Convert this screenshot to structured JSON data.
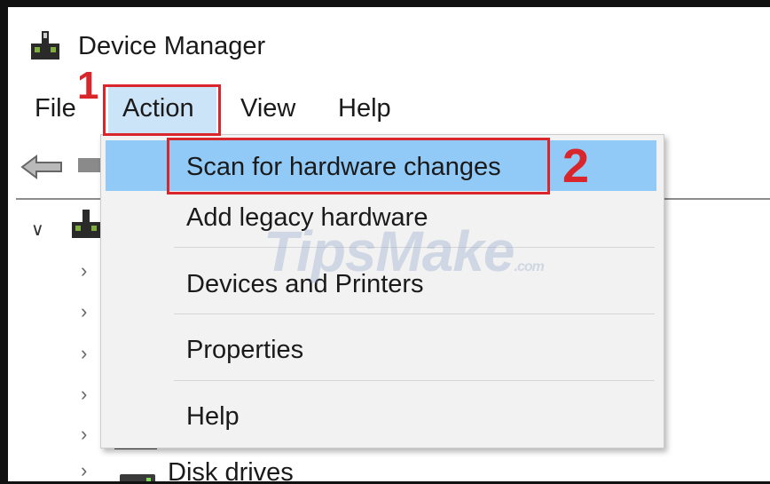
{
  "window": {
    "title": "Device Manager"
  },
  "menubar": {
    "items": [
      "File",
      "Action",
      "View",
      "Help"
    ],
    "active": "Action"
  },
  "dropdown": {
    "items": [
      {
        "label": "Scan for hardware changes",
        "highlighted": true
      },
      {
        "label": "Add legacy hardware"
      },
      {
        "label": "Devices and Printers"
      },
      {
        "label": "Properties"
      },
      {
        "label": "Help"
      }
    ]
  },
  "tree": {
    "visible_nodes": [
      {
        "label": "Disk drives"
      }
    ]
  },
  "annotations": {
    "step1": "1",
    "step2": "2",
    "color": "#d9262c"
  },
  "watermark": {
    "text": "TipsMake",
    "suffix": ".com"
  },
  "colors": {
    "menu_active_bg": "#cce4f7",
    "dropdown_bg": "#f2f2f2",
    "dropdown_highlight": "#91c9f7"
  },
  "icons": {
    "app": "device-manager-icon",
    "back": "back-arrow-icon",
    "forward": "forward-arrow-icon",
    "expand": "chevron-right-icon",
    "collapse": "chevron-down-icon",
    "disk": "disk-drive-icon"
  }
}
